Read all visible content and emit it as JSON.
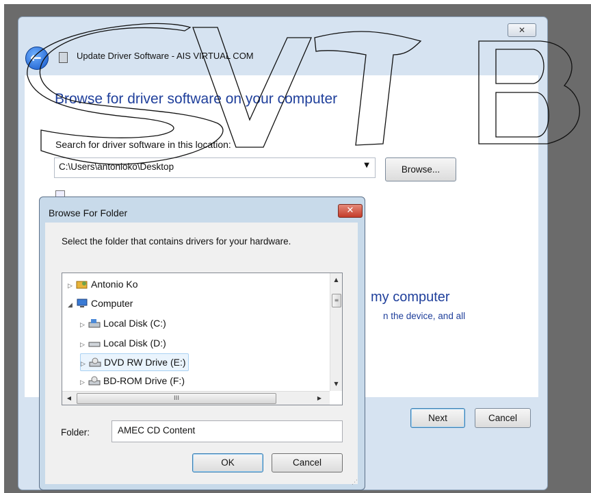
{
  "window": {
    "title": "Update Driver Software - AIS VIRTUAL COM",
    "close_label": "✕",
    "heading": "Browse for driver software on your computer",
    "search_label": "Search for driver software in this location:",
    "path_value": "C:\\Users\\antonioko\\Desktop",
    "browse_label": "Browse...",
    "pick_heading": "my computer",
    "pick_desc": "n the device, and all",
    "next_label": "Next",
    "cancel_label": "Cancel"
  },
  "dialog": {
    "title": "Browse For Folder",
    "close_label": "✕",
    "description": "Select the folder that contains drivers for your hardware.",
    "tree": [
      {
        "label": "Antonio Ko",
        "toggle": "▷",
        "icon": "user-folder-icon",
        "selected": false
      },
      {
        "label": "Computer",
        "toggle": "◢",
        "icon": "computer-icon",
        "selected": false
      },
      {
        "label": "Local Disk (C:)",
        "toggle": "▷",
        "icon": "system-drive-icon",
        "selected": false
      },
      {
        "label": "Local Disk (D:)",
        "toggle": "▷",
        "icon": "drive-icon",
        "selected": false
      },
      {
        "label": "DVD RW Drive (E:)",
        "toggle": "▷",
        "icon": "dvd-drive-icon",
        "selected": true
      },
      {
        "label": "BD-ROM Drive (F:)",
        "toggle": "▷",
        "icon": "bd-drive-icon",
        "selected": false
      }
    ],
    "hscroll_thumb": "III",
    "vscroll_thumb": "≡",
    "folder_label": "Folder:",
    "folder_value": "AMEC CD Content",
    "ok_label": "OK",
    "cancel_label": "Cancel"
  },
  "colors": {
    "heading_blue": "#1f3f9b",
    "dialog_frame": "#c8daea",
    "close_red": "#c43c2a"
  }
}
